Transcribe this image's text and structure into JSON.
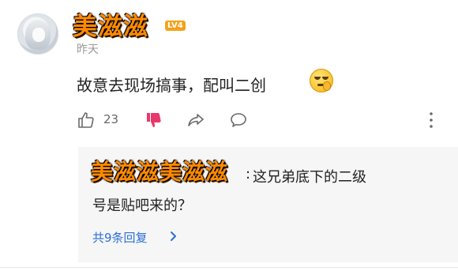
{
  "user": {
    "name": "美滋滋",
    "level": "LV4",
    "time": "昨天"
  },
  "comment": {
    "text": "故意去现场搞事，配叫二创",
    "emoji": "smirk-face-emoji"
  },
  "actions": {
    "like_count": "23"
  },
  "reply": {
    "author": "美滋滋美滋滋",
    "colon": ":",
    "text_line1": "这兄弟底下的二级",
    "text_line2": "号是贴吧来的？",
    "more": "共9条回复"
  },
  "colors": {
    "link": "#2b6fd6",
    "dislike": "#e8376b",
    "name_fill": "#ff8a00"
  }
}
